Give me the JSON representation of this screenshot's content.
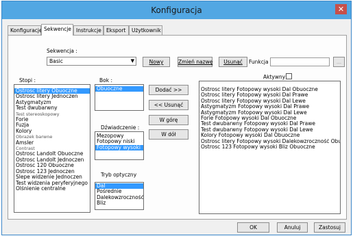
{
  "window": {
    "title": "Konfiguracja",
    "close_glyph": "✕"
  },
  "tabs": [
    "Konfiguracje",
    "Sekwencje",
    "Instrukcje",
    "Eksport",
    "Użytkownik"
  ],
  "sequence": {
    "label": "Sekwencja :",
    "value": "Basic"
  },
  "buttons": {
    "new": "Nowy",
    "rename": "Zmień nazwę",
    "delete": "Usunąć",
    "add": "Dodać >>",
    "remove": "<< Usunąć",
    "up": "W górę",
    "down": "W dół",
    "ok": "OK",
    "cancel": "Anuluj",
    "apply": "Zastosuj"
  },
  "function_label": "Funkcja :",
  "browse_label": "...",
  "active_label": "Aktywny!",
  "steps": {
    "label": "Stopi :",
    "items": [
      {
        "text": "Ostrosc litery Obuoczne",
        "selected": true
      },
      {
        "text": "Ostrosc litery Jednoczen"
      },
      {
        "text": "Astygmatyzm"
      },
      {
        "text": "Test dwubarwny"
      },
      {
        "text": "Test stereoskopowy",
        "dim": true
      },
      {
        "text": "Forie"
      },
      {
        "text": "Fuzja"
      },
      {
        "text": "Kolory"
      },
      {
        "text": "Obrazek barwne",
        "dim": true
      },
      {
        "text": "Amsler"
      },
      {
        "text": "Contrast",
        "dim": true
      },
      {
        "text": "Ostrosc Landolt Obuoczne"
      },
      {
        "text": "Ostrosc Landolt Jednoczen"
      },
      {
        "text": "Ostrosc 120 Obuoczne"
      },
      {
        "text": "Ostrosc 123 Jednoczen"
      },
      {
        "text": "Slepe widzenie Jednoczen"
      },
      {
        "text": "Test widzenia peryferyjnego"
      },
      {
        "text": "Olśnienie centralne"
      }
    ]
  },
  "eye": {
    "label": "Bok :",
    "items": [
      {
        "text": "Obuoczne",
        "selected": true
      }
    ]
  },
  "visibility": {
    "label": "Dźwiadczenie :",
    "items": [
      {
        "text": "Mezopowy"
      },
      {
        "text": "Fotopowy niski"
      },
      {
        "text": "Fotopowy wysoki",
        "selected": true
      }
    ]
  },
  "optical": {
    "label": "Tryb optyczny",
    "items": [
      {
        "text": "Dal",
        "selected": true
      },
      {
        "text": "Pośrednie"
      },
      {
        "text": "Dalekowzroczność"
      },
      {
        "text": "Bliz"
      }
    ]
  },
  "sequence_items": [
    "Ostrosc litery  Fotopowy wysoki  Dal  Obuoczne",
    "Ostrosc litery  Fotopowy wysoki  Dal  Prawe",
    "Ostrosc litery  Fotopowy wysoki  Dal  Lewe",
    "Astygmatyzm  Fotopowy wysoki  Dal  Prawe",
    "Astygmatyzm  Fotopowy wysoki  Dal  Lewe",
    "Forie  Fotopowy wysoki  Dal  Obuoczne",
    "Test dwubarwny  Fotopowy wysoki  Dal  Prawe",
    "Test dwubarwny  Fotopowy wysoki  Dal  Lewe",
    "Kolory  Fotopowy wysoki  Dal  Obuoczne",
    "Ostrosc litery  Fotopowy wysoki  Dalekowzroczność  Obuocz",
    "Ostrosc 123  Fotopowy wysoki  Bliz  Obuoczne"
  ],
  "icons": {
    "dropdown": "chevron-down-icon",
    "close": "close-icon",
    "checkbox": "checkbox-icon"
  }
}
